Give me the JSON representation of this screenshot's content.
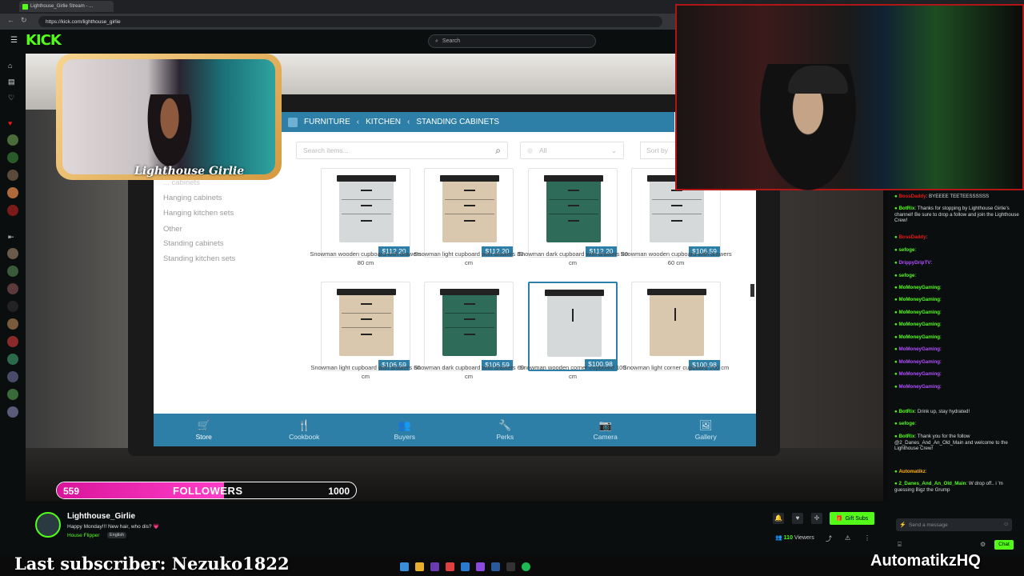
{
  "browser": {
    "tab_title": "Lighthouse_Girlie Stream - ...",
    "url": "https://kick.com/lighthouse_girlie"
  },
  "kick": {
    "logo": "KICK",
    "search_placeholder": "Search"
  },
  "game": {
    "breadcrumb": [
      "FURNITURE",
      "KITCHEN",
      "STANDING CABINETS"
    ],
    "search_placeholder": "Search items...",
    "filter_all": "All",
    "sort_label": "Sort by",
    "categories": [
      "... cabinets",
      "Hanging cabinets",
      "Hanging kitchen sets",
      "Other",
      "Standing cabinets",
      "Standing kitchen sets"
    ],
    "items": [
      {
        "name": "Snowman wooden cupboard with drawers 80 cm",
        "price": "$112.20",
        "color": "#d6d9da"
      },
      {
        "name": "Snowman light cupboard with drawers 80 cm",
        "price": "$112.20",
        "color": "#d9c7ae"
      },
      {
        "name": "Snowman dark cupboard with drawers 80 cm",
        "price": "$112.20",
        "color": "#2e6b58"
      },
      {
        "name": "Snowman wooden cupboard with drawers 60 cm",
        "price": "$106.59",
        "color": "#d6d9da"
      },
      {
        "name": "Snowman light cupboard with drawers 60 cm",
        "price": "$106.59",
        "color": "#d9c7ae"
      },
      {
        "name": "Snowman dark cupboard with drawers 60 cm",
        "price": "$106.59",
        "color": "#2e6b58"
      },
      {
        "name": "Snowman wooden corner cupboard 100 cm",
        "price": "$100.98",
        "color": "#d6d9da"
      },
      {
        "name": "Snowman light corner cupboard 100 cm",
        "price": "$100.98",
        "color": "#d9c7ae"
      }
    ],
    "nav": [
      {
        "label": "Store",
        "icon": "cart-icon"
      },
      {
        "label": "Cookbook",
        "icon": "cutlery-icon"
      },
      {
        "label": "Buyers",
        "icon": "people-icon"
      },
      {
        "label": "Perks",
        "icon": "wrench-icon"
      },
      {
        "label": "Camera",
        "icon": "camera-icon"
      },
      {
        "label": "Gallery",
        "icon": "picture-icon"
      }
    ]
  },
  "cam1_text": "Lighthouse Girlie",
  "followers": {
    "current": "559",
    "label": "FOLLOWERS",
    "goal": "1000",
    "progress_fraction": 0.559
  },
  "stream": {
    "name": "Lighthouse_Girlie",
    "title": "Happy Monday!!! New hair, who dis? 💗",
    "category": "House Flipper",
    "language": "English",
    "gift_label": "Gift Subs",
    "viewers_count": "110",
    "viewers_label": "Viewers"
  },
  "chat": {
    "messages": [
      {
        "user": "BossDaddy",
        "text": ": BYEEEE TEETEESSSSSS",
        "color": "#e91916"
      },
      {
        "user": "BotRix",
        "text": ": Thanks for stopping by Lighthouse Girlie's channel! Be sure to drop a follow and join the Lighthouse Crew!",
        "color": "#53fc18"
      },
      {
        "user": "BossDaddy",
        "text": ":",
        "color": "#e91916"
      },
      {
        "user": "sefoge",
        "text": ":",
        "color": "#53fc18"
      },
      {
        "user": "DrippyDripTV",
        "text": ":",
        "color": "#b14dff"
      },
      {
        "user": "sefoge",
        "text": ":",
        "color": "#53fc18"
      },
      {
        "user": "MoMoneyGaming",
        "text": ":",
        "color": "#53fc18"
      },
      {
        "user": "MoMoneyGaming",
        "text": ":",
        "color": "#53fc18"
      },
      {
        "user": "MoMoneyGaming",
        "text": ":",
        "color": "#53fc18"
      },
      {
        "user": "MoMoneyGaming",
        "text": ":",
        "color": "#53fc18"
      },
      {
        "user": "MoMoneyGaming",
        "text": ":",
        "color": "#53fc18"
      },
      {
        "user": "MoMoneyGaming",
        "text": ":",
        "color": "#b14dff"
      },
      {
        "user": "MoMoneyGaming",
        "text": ":",
        "color": "#b14dff"
      },
      {
        "user": "MoMoneyGaming",
        "text": ":",
        "color": "#b14dff"
      },
      {
        "user": "MoMoneyGaming",
        "text": ":",
        "color": "#b14dff"
      },
      {
        "user": "BotRix",
        "text": ": Drink up, stay hydrated!",
        "color": "#53fc18"
      },
      {
        "user": "sefoge",
        "text": ":",
        "color": "#53fc18"
      },
      {
        "user": "BotRix",
        "text": ": Thank you for the follow @2_Danes_And_An_Old_Main and welcome to the Lighthouse Crew!",
        "color": "#53fc18"
      },
      {
        "user": "Automatikz",
        "text": ":",
        "color": "#ffb000"
      },
      {
        "user": "2_Danes_And_An_Old_Main",
        "text": ": W drop off.. i 'm guessing Bigz the Grump",
        "color": "#53fc18"
      }
    ],
    "input_placeholder": "Send a message",
    "chat_button": "Chat"
  },
  "overlay": {
    "last_subscriber": "Last subscriber: Nezuko1822",
    "handle": "AutomatikzHQ"
  },
  "colors": {
    "kick_green": "#53fc18",
    "game_blue": "#2e7fa8",
    "follower_pink": "#ff3ec9"
  }
}
